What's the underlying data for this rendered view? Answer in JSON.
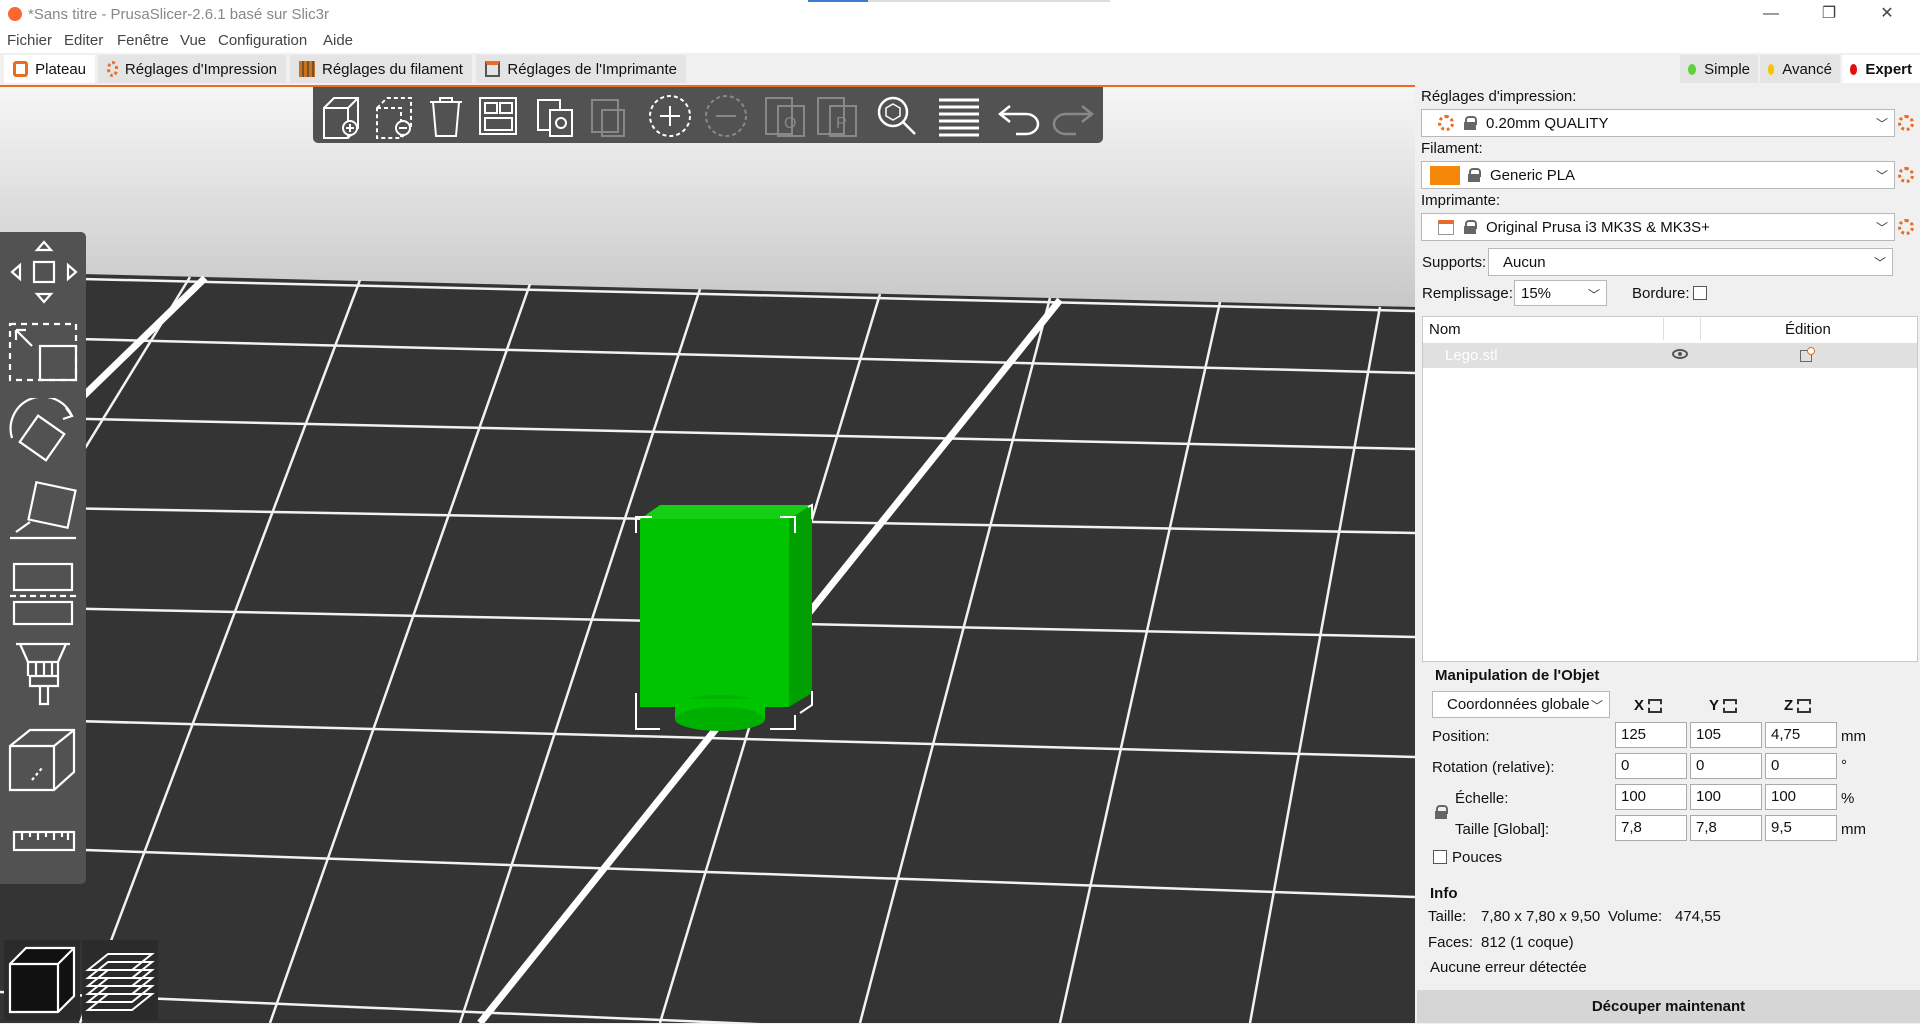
{
  "window": {
    "title": "*Sans titre - PrusaSlicer-2.6.1 basé sur Slic3r",
    "minimize": "—",
    "restore": "❐",
    "close": "✕"
  },
  "menu": [
    "Fichier",
    "Editer",
    "Fenêtre",
    "Vue",
    "Configuration",
    "Aide"
  ],
  "tabs": [
    {
      "label": "Plateau",
      "icon": "plater-icon",
      "active": true
    },
    {
      "label": "Réglages d'Impression",
      "icon": "gear-icon",
      "active": false
    },
    {
      "label": "Réglages du filament",
      "icon": "spool-icon",
      "active": false
    },
    {
      "label": "Réglages de l'Imprimante",
      "icon": "printer-icon",
      "active": false
    }
  ],
  "modes": [
    {
      "label": "Simple",
      "color": "#5fd33a"
    },
    {
      "label": "Avancé",
      "color": "#f7c500"
    },
    {
      "label": "Expert",
      "color": "#e20d0d",
      "active": true
    }
  ],
  "toolbar": {
    "icons": [
      "add-icon",
      "delete-icon",
      "delete-all-icon",
      "arrange-icon",
      "copy-icon",
      "paste-icon",
      "add-instance-icon",
      "remove-instance-icon",
      "split-objects-icon",
      "split-parts-icon",
      "search-icon",
      "layers-editing-icon",
      "undo-icon",
      "redo-icon"
    ]
  },
  "left_toolbar": {
    "icons": [
      "move-icon",
      "scale-icon",
      "rotate-icon",
      "place-on-face-icon",
      "cut-icon",
      "supports-paint-icon",
      "measure-cube-icon",
      "ruler-icon"
    ]
  },
  "right_panel": {
    "print_settings_label": "Réglages d'impression:",
    "print_settings_value": "0.20mm QUALITY",
    "filament_label": "Filament:",
    "filament_value": "Generic PLA",
    "filament_color": "#f5880a",
    "printer_label": "Imprimante:",
    "printer_value": "Original Prusa i3 MK3S & MK3S+",
    "supports_label": "Supports:",
    "supports_value": "Aucun",
    "infill_label": "Remplissage:",
    "infill_value": "15%",
    "brim_label": "Bordure:",
    "list_headers": {
      "name": "Nom",
      "edit": "Édition"
    },
    "objects": [
      {
        "name": "Lego.stl"
      }
    ]
  },
  "manipulation": {
    "title": "Manipulation de l'Objet",
    "coords_value": "Coordonnées globale",
    "axes": [
      "X",
      "Y",
      "Z"
    ],
    "rows": [
      {
        "label": "Position:",
        "values": [
          "125",
          "105",
          "4,75"
        ],
        "unit": "mm"
      },
      {
        "label": "Rotation (relative):",
        "values": [
          "0",
          "0",
          "0"
        ],
        "unit": "°"
      },
      {
        "label": "Échelle:",
        "values": [
          "100",
          "100",
          "100"
        ],
        "unit": "%"
      },
      {
        "label": "Taille [Global]:",
        "values": [
          "7,8",
          "7,8",
          "9,5"
        ],
        "unit": "mm"
      }
    ],
    "inches_label": "Pouces"
  },
  "info": {
    "title": "Info",
    "size_label": "Taille:",
    "size_value": "7,80 x 7,80 x 9,50",
    "volume_label": "Volume:",
    "volume_value": "474,55",
    "faces_label": "Faces:",
    "faces_value": "812 (1 coque)",
    "errors": "Aucune erreur détectée"
  },
  "slice_button": "Découper maintenant",
  "colors": {
    "accent": "#ed6b21",
    "model": "#00c400"
  }
}
